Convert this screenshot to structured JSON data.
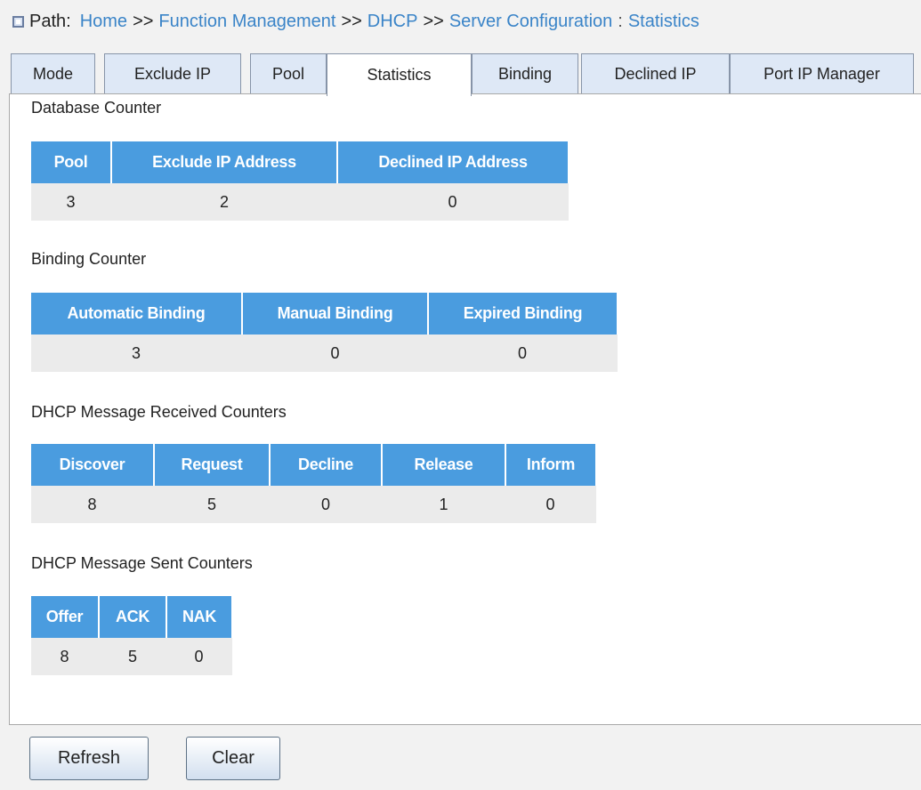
{
  "path": {
    "label": "Path:",
    "crumbs": [
      "Home",
      "Function Management",
      "DHCP",
      "Server Configuration"
    ],
    "separator": ">>",
    "colon": ":",
    "current": "Statistics"
  },
  "tabs": [
    {
      "label": "Mode"
    },
    {
      "label": "Exclude IP"
    },
    {
      "label": "Pool"
    },
    {
      "label": "Statistics",
      "active": true
    },
    {
      "label": "Binding"
    },
    {
      "label": "Declined IP"
    },
    {
      "label": "Port IP Manager"
    }
  ],
  "database": {
    "title": "Database Counter",
    "headers": [
      "Pool",
      "Exclude IP Address",
      "Declined IP Address"
    ],
    "values": [
      "3",
      "2",
      "0"
    ]
  },
  "binding": {
    "title": "Binding Counter",
    "headers": [
      "Automatic Binding",
      "Manual Binding",
      "Expired Binding"
    ],
    "values": [
      "3",
      "0",
      "0"
    ]
  },
  "received": {
    "title": "DHCP Message Received Counters",
    "headers": [
      "Discover",
      "Request",
      "Decline",
      "Release",
      "Inform"
    ],
    "values": [
      "8",
      "5",
      "0",
      "1",
      "0"
    ]
  },
  "sent": {
    "title": "DHCP Message Sent Counters",
    "headers": [
      "Offer",
      "ACK",
      "NAK"
    ],
    "values": [
      "8",
      "5",
      "0"
    ]
  },
  "buttons": {
    "refresh": "Refresh",
    "clear": "Clear"
  },
  "colors": {
    "header_bg": "#4a9cdf",
    "cell_bg": "#ebebeb",
    "link": "#3a84c8",
    "tab_bg": "#dee8f6"
  }
}
